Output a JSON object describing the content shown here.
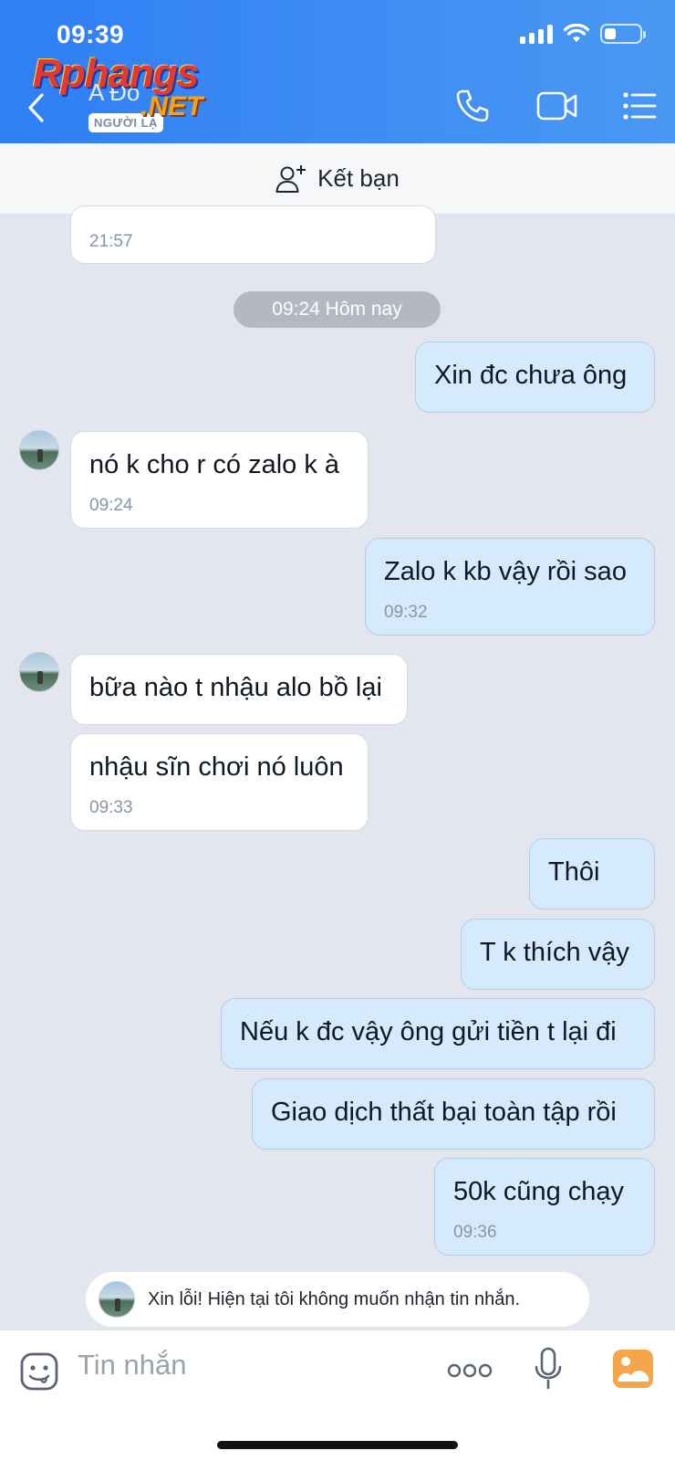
{
  "status_bar": {
    "time": "09:39"
  },
  "header": {
    "contact_name": "A Đô",
    "badge": "NGƯỜI LẠ",
    "watermark_main": "Rphangs",
    "watermark_sub": ".NET"
  },
  "friend_bar": {
    "label": "Kết bạn"
  },
  "conversation": {
    "partial_message_time": "21:57",
    "date_separator": "09:24 Hôm nay",
    "messages": [
      {
        "side": "out",
        "text": "Xin đc chưa ông",
        "time": ""
      },
      {
        "side": "in",
        "text": "nó k cho r có zalo k à",
        "time": "09:24"
      },
      {
        "side": "out",
        "text": "Zalo k kb vậy rồi sao",
        "time": "09:32"
      },
      {
        "side": "in",
        "text": "bữa nào t nhậu alo bồ lại",
        "time": ""
      },
      {
        "side": "in",
        "text": "nhậu sĩn chơi nó luôn",
        "time": "09:33"
      },
      {
        "side": "out",
        "text": "Thôi",
        "time": ""
      },
      {
        "side": "out",
        "text": "T k thích vậy",
        "time": ""
      },
      {
        "side": "out",
        "text": "Nếu k đc vậy ông gửi tiền t lại đi",
        "time": ""
      },
      {
        "side": "out",
        "text": "Giao dịch thất bại toàn tập rồi",
        "time": ""
      },
      {
        "side": "out",
        "text": "50k cũng chạy",
        "time": "09:36"
      }
    ],
    "auto_reply_notice": "Xin lỗi! Hiện tại tôi không muốn nhận tin nhắn."
  },
  "composer": {
    "placeholder": "Tin nhắn"
  },
  "colors": {
    "header_blue": "#2f7ff5",
    "outgoing_bubble": "#d5ebfd",
    "incoming_bubble": "#ffffff",
    "chat_bg": "#e3e6ee"
  },
  "icons": [
    "back-icon",
    "phone-icon",
    "video-call-icon",
    "menu-list-icon",
    "add-friend-icon",
    "sticker-icon",
    "more-icon",
    "microphone-icon",
    "image-icon"
  ]
}
